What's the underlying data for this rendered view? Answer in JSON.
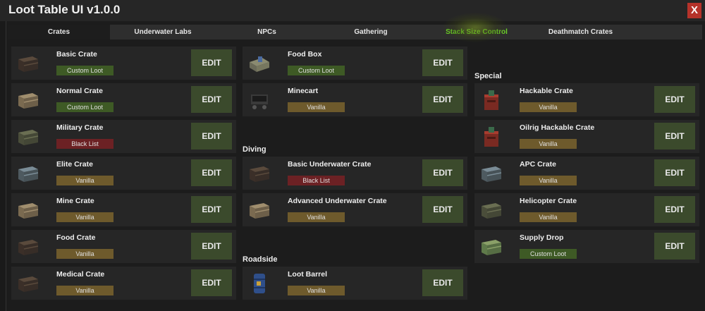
{
  "app": {
    "title": "Loot Table UI v1.0.0",
    "close_label": "X"
  },
  "tabs": [
    {
      "label": "Crates"
    },
    {
      "label": "Underwater Labs"
    },
    {
      "label": "NPCs"
    },
    {
      "label": "Gathering"
    },
    {
      "label": "Stack Size Control"
    },
    {
      "label": "Deathmatch Crates"
    }
  ],
  "colors": {
    "accent_green_text": "#6dd629",
    "edit_button": "#3b4a2c",
    "badge_custom": "#3e5a25",
    "badge_vanilla": "#6e5a2c",
    "badge_blacklist": "#6c2124",
    "close_button": "#b5322a"
  },
  "edit_label": "EDIT",
  "sections": {
    "diving": "Diving",
    "roadside": "Roadside",
    "special": "Special"
  },
  "col1": [
    {
      "name": "Basic Crate",
      "status": "Custom Loot",
      "icon": "basic-crate-icon"
    },
    {
      "name": "Normal Crate",
      "status": "Custom Loot",
      "icon": "normal-crate-icon"
    },
    {
      "name": "Military Crate",
      "status": "Black List",
      "icon": "military-crate-icon"
    },
    {
      "name": "Elite Crate",
      "status": "Vanilla",
      "icon": "elite-crate-icon"
    },
    {
      "name": "Mine Crate",
      "status": "Vanilla",
      "icon": "mine-crate-icon"
    },
    {
      "name": "Food Crate",
      "status": "Vanilla",
      "icon": "food-crate-icon"
    },
    {
      "name": "Medical Crate",
      "status": "Vanilla",
      "icon": "medical-crate-icon"
    }
  ],
  "col2": [
    {
      "name": "Food Box",
      "status": "Custom Loot",
      "icon": "food-box-icon"
    },
    {
      "name": "Minecart",
      "status": "Vanilla",
      "icon": "minecart-icon"
    },
    {
      "name": "Basic Underwater Crate",
      "status": "Black List",
      "icon": "underwater-crate-icon"
    },
    {
      "name": "Advanced Underwater Crate",
      "status": "Vanilla",
      "icon": "advanced-underwater-crate-icon"
    },
    {
      "name": "Loot Barrel",
      "status": "Vanilla",
      "icon": "loot-barrel-icon"
    }
  ],
  "col3": [
    {
      "name": "Hackable Crate",
      "status": "Vanilla",
      "icon": "hackable-crate-icon"
    },
    {
      "name": "Oilrig Hackable Crate",
      "status": "Vanilla",
      "icon": "oilrig-hackable-crate-icon"
    },
    {
      "name": "APC Crate",
      "status": "Vanilla",
      "icon": "apc-crate-icon"
    },
    {
      "name": "Helicopter Crate",
      "status": "Vanilla",
      "icon": "helicopter-crate-icon"
    },
    {
      "name": "Supply Drop",
      "status": "Custom Loot",
      "icon": "supply-drop-icon"
    }
  ]
}
